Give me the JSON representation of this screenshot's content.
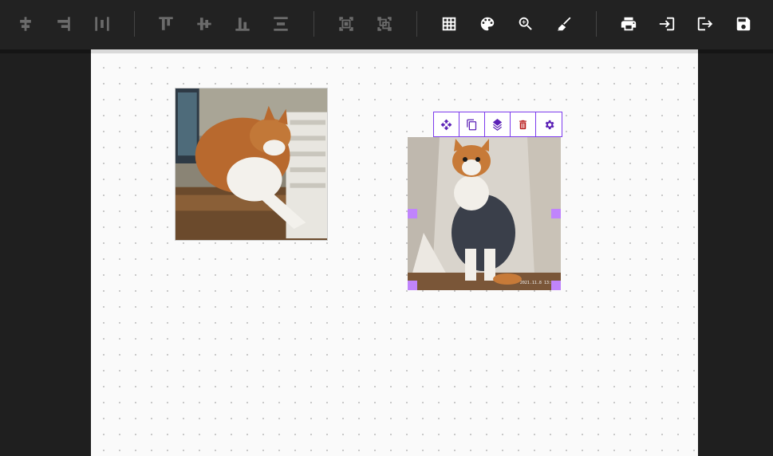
{
  "toolbar": {
    "groups": [
      {
        "name": "distribute",
        "buttons": [
          "distribute-horizontal-center-icon",
          "align-right-edges-icon",
          "distribute-horizontal-icon"
        ]
      },
      {
        "name": "align",
        "buttons": [
          "align-top-icon",
          "align-vertical-center-icon",
          "align-bottom-icon",
          "distribute-vertical-icon"
        ]
      },
      {
        "name": "group",
        "buttons": [
          "group-icon",
          "ungroup-icon"
        ]
      },
      {
        "name": "view",
        "buttons": [
          "grid-icon",
          "palette-icon",
          "zoom-icon",
          "brush-icon"
        ]
      },
      {
        "name": "file",
        "buttons": [
          "print-icon",
          "import-icon",
          "export-icon",
          "save-icon"
        ]
      }
    ],
    "colors": {
      "background": "#222222",
      "disabled_icon": "#6b6b6b",
      "enabled_icon": "#ffffff"
    }
  },
  "canvas": {
    "background": "#fafafa",
    "dot_grid": true,
    "items": [
      {
        "name": "cat-photo-1",
        "description_icon": "image-icon",
        "selected": false
      },
      {
        "name": "cat-photo-2",
        "description_icon": "image-icon",
        "selected": true,
        "timestamp": "2021.11.8 13:33"
      }
    ]
  },
  "selection_toolbar": {
    "buttons": [
      "move-icon",
      "copy-icon",
      "layers-icon",
      "delete-icon",
      "settings-icon"
    ],
    "accent": "#7c3aed",
    "delete_color": "#b91c1c",
    "handle_color": "#c084fc"
  }
}
